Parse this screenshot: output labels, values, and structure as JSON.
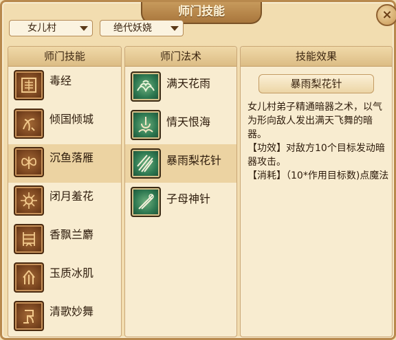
{
  "window": {
    "title": "师门技能",
    "close_glyph": "×"
  },
  "filters": {
    "sect": "女儿村",
    "talent": "绝代妖娆"
  },
  "columns": {
    "skills": "师门技能",
    "spells": "师门法术",
    "effect": "技能效果"
  },
  "skills": [
    {
      "label": "毒经",
      "icon": "scroll-icon"
    },
    {
      "label": "倾国倾城",
      "icon": "beauty-icon"
    },
    {
      "label": "沉鱼落雁",
      "icon": "butterfly-icon",
      "selected": true
    },
    {
      "label": "闭月羞花",
      "icon": "flower-icon"
    },
    {
      "label": "香飘兰麝",
      "icon": "orchid-icon"
    },
    {
      "label": "玉质冰肌",
      "icon": "jade-icon"
    },
    {
      "label": "清歌妙舞",
      "icon": "dance-icon"
    }
  ],
  "spells": [
    {
      "label": "满天花雨",
      "icon": "flower-rain-icon"
    },
    {
      "label": "情天恨海",
      "icon": "sea-icon"
    },
    {
      "label": "暴雨梨花针",
      "icon": "needles-icon",
      "selected": true
    },
    {
      "label": "子母神针",
      "icon": "twin-needle-icon"
    }
  ],
  "effect": {
    "name": "暴雨梨花针",
    "lines": [
      "女儿村弟子精通暗器之术，以气为形向敌人发出满天飞舞的暗器。",
      "【功效】对敌方10个目标发动暗器攻击。",
      "【消耗】（10*作用目标数)点魔法"
    ]
  }
}
